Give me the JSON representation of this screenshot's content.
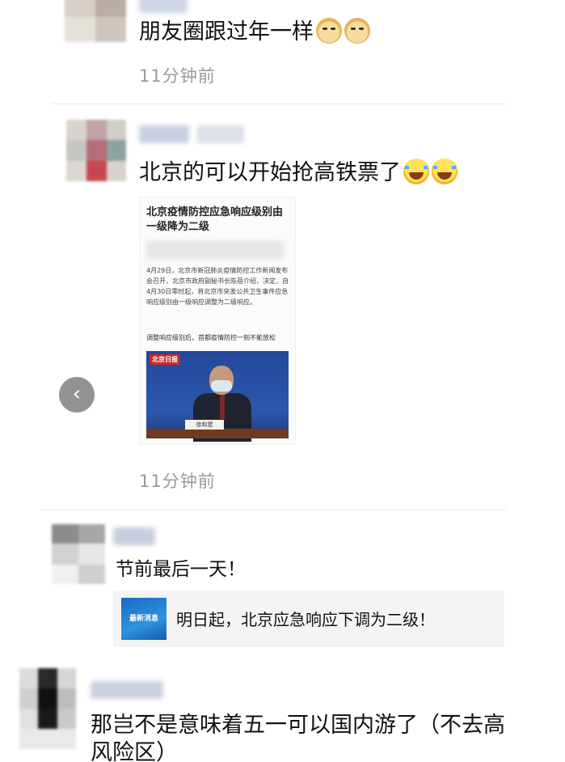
{
  "posts": [
    {
      "text": "朋友圈跟过年一样",
      "emojis": [
        "doge-icon",
        "doge-icon"
      ],
      "time": "11分钟前"
    },
    {
      "text": "北京的可以开始抢高铁票了",
      "emojis": [
        "laugh-cry-icon",
        "laugh-cry-icon"
      ],
      "time": "11分钟前",
      "image": {
        "title": "北京疫情防控应急响应级别由一级降为二级",
        "body": "4月29日，北京市新冠肺炎疫情防控工作新闻发布会召开，北京市政府副秘书长陈蓓介绍，决定，自4月30日零时起，将北京市突发公共卫生事件应急响应级别由一级响应调整为二级响应。",
        "subtitle": "调整响应级别后，首都疫情防控一刻不能放松",
        "logo": "北京日报",
        "nameplate": "徐和建"
      }
    }
  ],
  "comments": [
    {
      "text": "节前最后一天！",
      "link": {
        "thumb_label": "最新消息",
        "title": "明日起，北京应急响应下调为二级！"
      }
    },
    {
      "text": "那岂不是意味着五一可以国内游了（不去高",
      "text_line2": "风险区）"
    }
  ],
  "colors": {
    "time_gray": "#9a9a9a",
    "divider": "#e8e8e8",
    "link_card_bg": "#f4f4f4"
  }
}
